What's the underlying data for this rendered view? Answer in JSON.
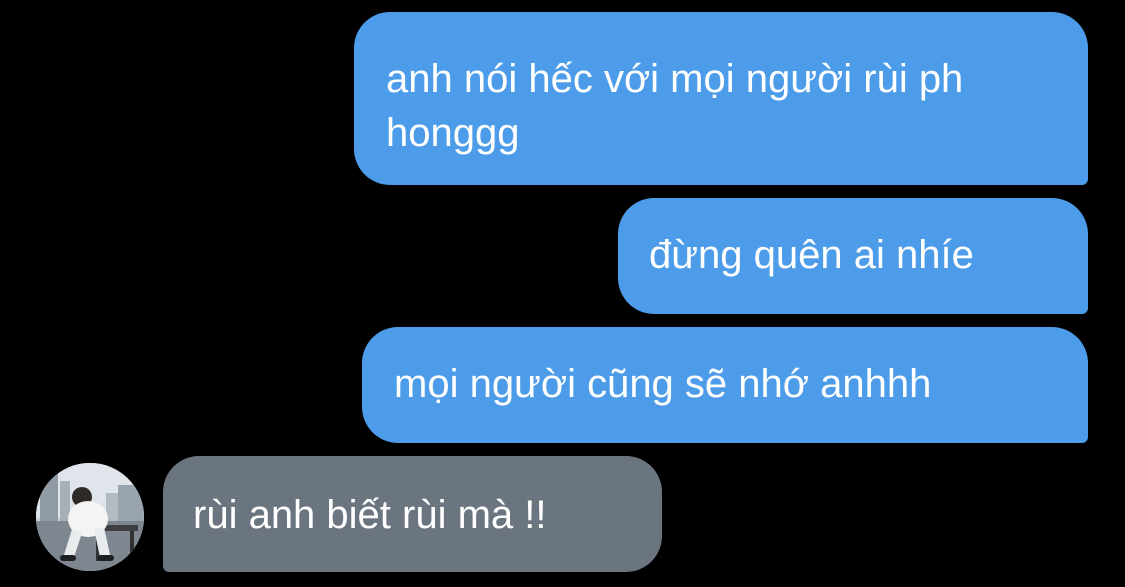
{
  "conversation": {
    "messages": [
      {
        "sender": "me",
        "text": "anh nói hếc với mọi người rùi ph honggg"
      },
      {
        "sender": "me",
        "text": "đừng quên ai nhíe"
      },
      {
        "sender": "me",
        "text": "mọi người cũng sẽ nhớ anhhh"
      },
      {
        "sender": "other",
        "text": "rùi anh biết rùi mà !!"
      }
    ],
    "other_avatar_icon": "person-photo-avatar"
  },
  "colors": {
    "background": "#000000",
    "sent_bubble": "#4c9ce9",
    "received_bubble": "#6b7580",
    "text": "#ffffff"
  }
}
